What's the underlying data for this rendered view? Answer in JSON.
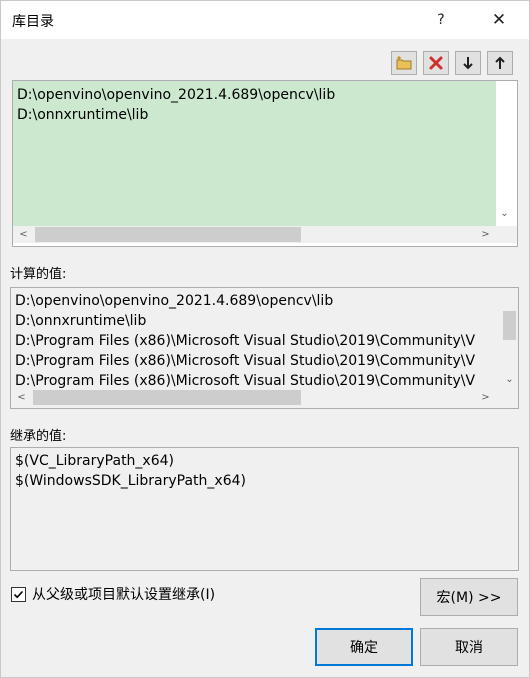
{
  "window": {
    "title": "库目录",
    "help": "?",
    "close": "✕"
  },
  "directories": {
    "lines": [
      "D:\\openvino\\openvino_2021.4.689\\opencv\\lib",
      "D:\\onnxruntime\\lib"
    ]
  },
  "computed": {
    "label": "计算的值:",
    "lines": [
      "D:\\openvino\\openvino_2021.4.689\\opencv\\lib",
      "D:\\onnxruntime\\lib",
      "D:\\Program Files (x86)\\Microsoft Visual Studio\\2019\\Community\\V",
      "D:\\Program Files (x86)\\Microsoft Visual Studio\\2019\\Community\\V",
      "D:\\Program Files (x86)\\Microsoft Visual Studio\\2019\\Community\\V"
    ]
  },
  "inherited": {
    "label": "继承的值:",
    "lines": [
      "$(VC_LibraryPath_x64)",
      "$(WindowsSDK_LibraryPath_x64)"
    ]
  },
  "inherit_checkbox": {
    "label": "从父级或项目默认设置继承(I)",
    "checked": true
  },
  "buttons": {
    "macro": "宏(M) >>",
    "ok": "确定",
    "cancel": "取消"
  },
  "colors": {
    "selection": "#cce8cf",
    "accent": "#0078d7"
  },
  "scrollbars": {
    "left_arrow": "<",
    "right_arrow": ">",
    "down_arrow": "⌄"
  }
}
